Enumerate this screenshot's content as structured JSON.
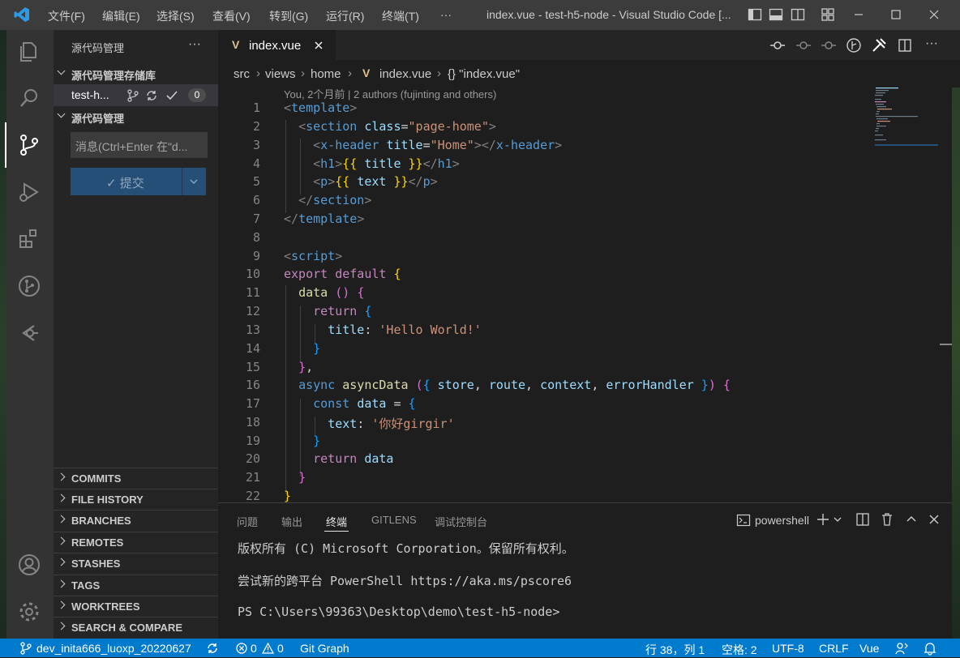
{
  "titlebar": {
    "menus": [
      "文件(F)",
      "编辑(E)",
      "选择(S)",
      "查看(V)",
      "转到(G)",
      "运行(R)",
      "终端(T)",
      "···"
    ],
    "title": "index.vue - test-h5-node - Visual Studio Code [..."
  },
  "sidebar": {
    "header": "源代码管理",
    "more": "···",
    "repos_title": "源代码管理存储库",
    "repo_name": "test-h...",
    "repo_count": "0",
    "scm_title": "源代码管理",
    "message_placeholder": "消息(Ctrl+Enter 在\"d...",
    "commit_label": "✓ 提交",
    "sections": [
      "COMMITS",
      "FILE HISTORY",
      "BRANCHES",
      "REMOTES",
      "STASHES",
      "TAGS",
      "WORKTREES",
      "SEARCH & COMPARE"
    ]
  },
  "editor": {
    "tab_label": "index.vue",
    "breadcrumb": {
      "p1": "src",
      "p2": "views",
      "p3": "home",
      "p4": "index.vue",
      "p5": "{} \"index.vue\""
    },
    "blame": "You, 2个月前 | 2 authors (fujinting and others)",
    "line_numbers": [
      "1",
      "2",
      "3",
      "4",
      "5",
      "6",
      "7",
      "8",
      "9",
      "10",
      "11",
      "12",
      "13",
      "14",
      "15",
      "16",
      "17",
      "18",
      "19",
      "20",
      "21",
      "22"
    ]
  },
  "panel": {
    "tabs": [
      "问题",
      "输出",
      "终端",
      "GITLENS",
      "调试控制台"
    ],
    "active_tab": "终端",
    "shell": "powershell",
    "lines": [
      "版权所有 (C) Microsoft Corporation。保留所有权利。",
      "尝试新的跨平台 PowerShell https://aka.ms/pscore6",
      "PS C:\\Users\\99363\\Desktop\\demo\\test-h5-node>"
    ]
  },
  "status": {
    "branch": "dev_inita666_luoxp_20220627",
    "errors": "0",
    "warnings": "0",
    "gitgraph": "Git Graph",
    "position": "行 38，列 1",
    "spaces": "空格: 2",
    "encoding": "UTF-8",
    "eol": "CRLF",
    "language": "Vue"
  },
  "colors": {
    "accent": "#007acc",
    "activity": "#333333",
    "sidebar": "#252526",
    "editor": "#1e1e1e"
  }
}
